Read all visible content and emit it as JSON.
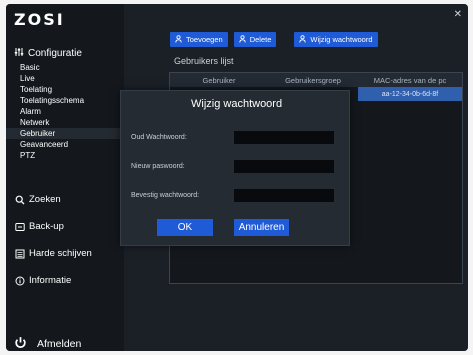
{
  "sidebar": {
    "logo": "ZOSI",
    "config_label": "Configuratie",
    "config_items": [
      {
        "label": "Basic"
      },
      {
        "label": "Live"
      },
      {
        "label": "Toelating"
      },
      {
        "label": "Toelatingsschema"
      },
      {
        "label": "Alarm"
      },
      {
        "label": "Netwerk"
      },
      {
        "label": "Gebruiker"
      },
      {
        "label": "Geavanceerd"
      },
      {
        "label": "PTZ"
      }
    ],
    "nav": [
      {
        "label": "Zoeken",
        "icon": "search-icon"
      },
      {
        "label": "Back-up",
        "icon": "backup-icon"
      },
      {
        "label": "Harde schijven",
        "icon": "hard-disk-icon"
      },
      {
        "label": "Informatie",
        "icon": "info-icon"
      }
    ],
    "logout_label": "Afmelden"
  },
  "toolbar": {
    "add_label": "Toevoegen",
    "delete_label": "Delete",
    "change_password_label": "Wijzig wachtwoord"
  },
  "users": {
    "title": "Gebruikers lijst",
    "columns": [
      "Gebruiker",
      "Gebruikersgroep",
      "MAC-adres van de pc"
    ],
    "rows": [
      {
        "user": "",
        "group": "",
        "mac": "aa-12-34-0b-6d-8f"
      }
    ]
  },
  "dialog": {
    "title": "Wijzig wachtwoord",
    "old_password_label": "Oud Wachtwoord:",
    "new_password_label": "Nieuw paswoord:",
    "confirm_password_label": "Bevestig wachtwoord:",
    "ok_label": "OK",
    "cancel_label": "Annuleren"
  },
  "colors": {
    "accent": "#1f5bd6",
    "background": "#0f1216",
    "selected_row": "#2f5fad"
  }
}
